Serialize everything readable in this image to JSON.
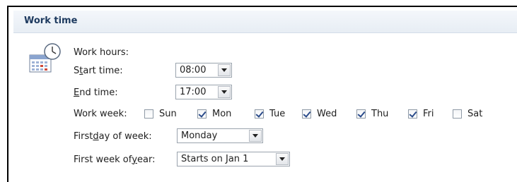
{
  "section": {
    "title": "Work time"
  },
  "work_hours": {
    "heading": "Work hours:",
    "start_time": {
      "label_pre": "S",
      "label_key": "t",
      "label_post": "art time:",
      "value": "08:00"
    },
    "end_time": {
      "label_key": "E",
      "label_post": "nd time:",
      "value": "17:00"
    }
  },
  "work_week": {
    "label": "Work week:",
    "days": [
      {
        "name": "Sun",
        "checked": false
      },
      {
        "name": "Mon",
        "checked": true
      },
      {
        "name": "Tue",
        "checked": true
      },
      {
        "name": "Wed",
        "checked": true
      },
      {
        "name": "Thu",
        "checked": true
      },
      {
        "name": "Fri",
        "checked": true
      },
      {
        "name": "Sat",
        "checked": false
      }
    ]
  },
  "first_day": {
    "label_pre": "First ",
    "label_key": "d",
    "label_post": "ay of week:",
    "value": "Monday"
  },
  "first_week": {
    "label_pre": "First week of ",
    "label_key": "y",
    "label_post": "ear:",
    "value": "Starts on Jan 1"
  },
  "icons": {
    "section_icon": "calendar-clock-icon",
    "dropdown_icon": "chevron-down-icon"
  }
}
